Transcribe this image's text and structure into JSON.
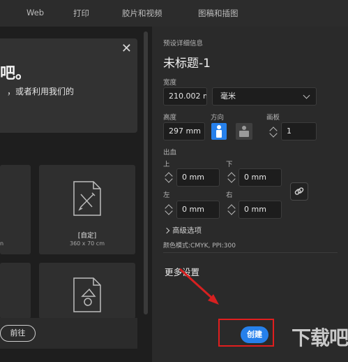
{
  "tabs": [
    "Web",
    "打印",
    "胶片和视频",
    "图稿和插图"
  ],
  "dialog": {
    "headline": "吧。",
    "line": "，或者利用我们的"
  },
  "cards": [
    {
      "stub": "n"
    },
    {
      "title": "[自定]",
      "size": "360 x 70 cm"
    }
  ],
  "goto_label": "前往",
  "preset": {
    "section_label": "预设详细信息",
    "doc_title": "未标题-1",
    "width_label": "宽度",
    "width_value": "210.002 mı",
    "unit": "毫米",
    "height_label": "高度",
    "height_value": "297 mm",
    "orientation_label": "方向",
    "artboard_label": "画板",
    "artboard_value": "1",
    "bleed_label": "出血",
    "top_label": "上",
    "top_value": "0 mm",
    "bottom_label": "下",
    "bottom_value": "0 mm",
    "left_label": "左",
    "left_value": "0 mm",
    "right_label": "右",
    "right_value": "0 mm",
    "advanced": "高级选项",
    "color_mode": "颜色模式:CMYK, PPI:300",
    "more_settings": "更多设置",
    "create_label": "创建"
  },
  "watermark": "下载吧",
  "colors": {
    "accent": "#2680eb",
    "highlight_box": "#e01e1e",
    "arrow": "#d62020"
  },
  "icons": [
    "close-icon",
    "portrait-icon",
    "landscape-icon",
    "link-icon",
    "chevron-right-icon",
    "chevron-down-icon",
    "document-icon"
  ]
}
